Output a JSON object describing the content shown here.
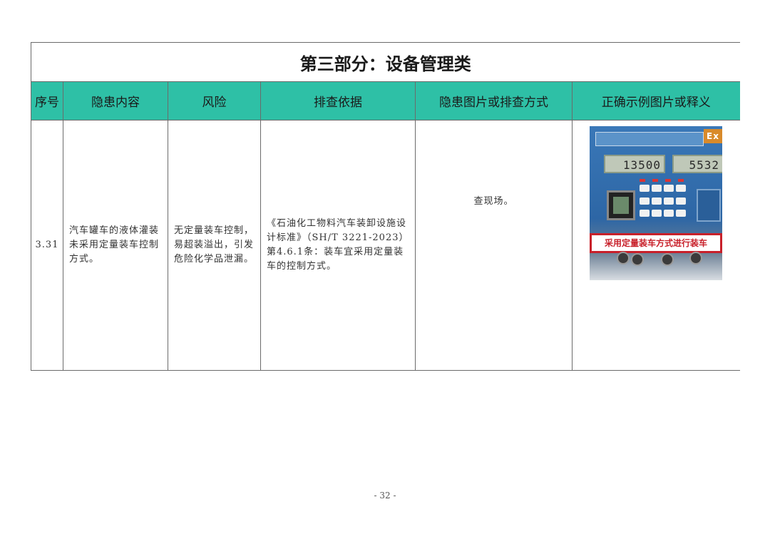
{
  "section_title": "第三部分：设备管理类",
  "headers": [
    "序号",
    "隐患内容",
    "风险",
    "排查依据",
    "隐患图片或排查方式",
    "正确示例图片或释义"
  ],
  "row": {
    "no": "3.31",
    "hazard": "汽车罐车的液体灌装未采用定量装车控制方式。",
    "risk": "无定量装车控制，易超装溢出，引发危险化学品泄漏。",
    "basis": "《石油化工物料汽车装卸设施设计标准》（SH/T 3221-2023）第4.6.1条：装车宜采用定量装车的控制方式。",
    "method": "查现场。",
    "photo": {
      "ex_label": "Ex",
      "display_1": "13500",
      "display_2": "5532",
      "caption": "采用定量装车方式进行装车",
      "caption_color": "#c8202a"
    }
  },
  "page_number": "- 32 -",
  "colors": {
    "header_bg": "#2ec0a6"
  }
}
